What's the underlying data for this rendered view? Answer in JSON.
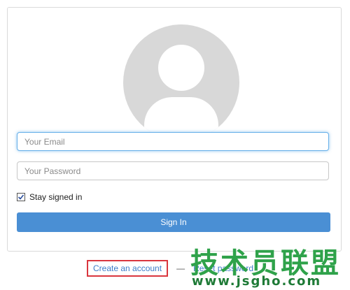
{
  "login": {
    "email_placeholder": "Your Email",
    "password_placeholder": "Your Password",
    "remember_label": "Stay signed in",
    "remember_checked": true,
    "signin_label": "Sign In"
  },
  "links": {
    "create_account": "Create an account",
    "separator": "—",
    "reset_password": "Reset password"
  },
  "watermark": {
    "main": "技术员联盟",
    "sub": "www.jsgho.com"
  },
  "colors": {
    "primary": "#4a8fd4",
    "link": "#3d7cc9",
    "highlight_box": "#d9363e",
    "watermark": "#2fa24a"
  }
}
